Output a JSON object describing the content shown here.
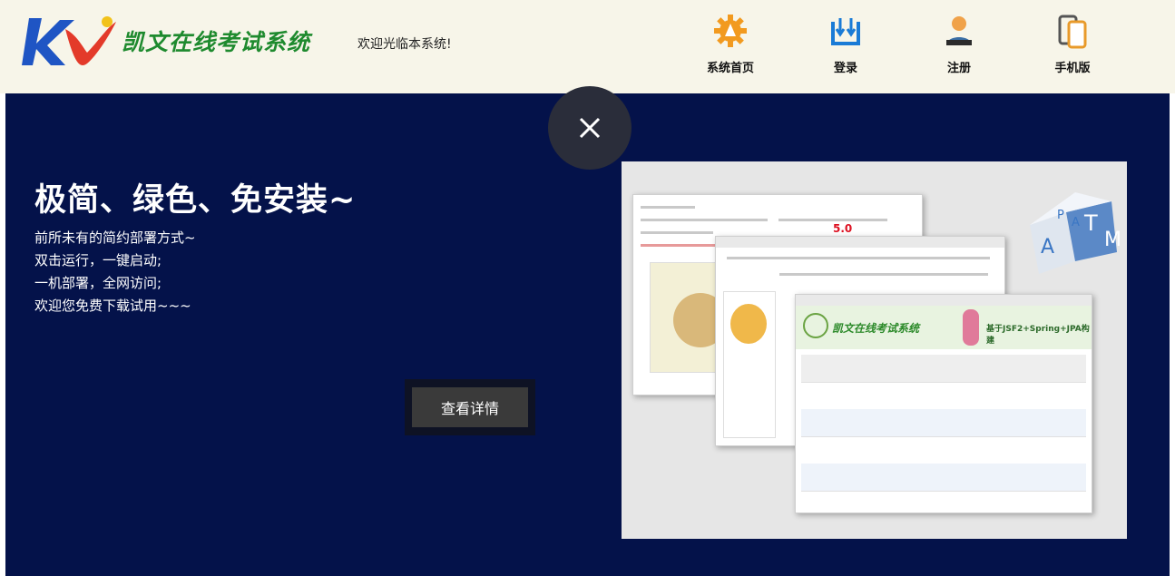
{
  "header": {
    "logo_mark": "KV",
    "logo_text": "凯文在线考试系统",
    "welcome": "欢迎光临本系统!",
    "nav": [
      {
        "label": "系统首页",
        "icon": "gear-icon",
        "color": "#f29a1f"
      },
      {
        "label": "登录",
        "icon": "login-icon",
        "color": "#1a7bd6"
      },
      {
        "label": "注册",
        "icon": "user-icon",
        "color": "#f0a24a"
      },
      {
        "label": "手机版",
        "icon": "phone-icon",
        "color": "#6b6b6b"
      }
    ]
  },
  "main": {
    "close_icon": "close-icon",
    "headline": "极简、绿色、免安装~",
    "lines": [
      "前所未有的简约部署方式~",
      "双击运行，一键启动;",
      "一机部署，全网访问;",
      "欢迎您免费下载试用~~~"
    ],
    "detail_button": "查看详情",
    "promo": {
      "score": "5.0",
      "banner_title": "凯文在线考试系统",
      "banner_subtitle": "基于JSF2+Spring+JPA构建",
      "cube_letters": [
        "A",
        "P",
        "A",
        "T",
        "M"
      ]
    }
  },
  "colors": {
    "topbar_bg": "#f7f5e9",
    "main_bg": "#04124a",
    "logo_green": "#1e8a2e"
  }
}
